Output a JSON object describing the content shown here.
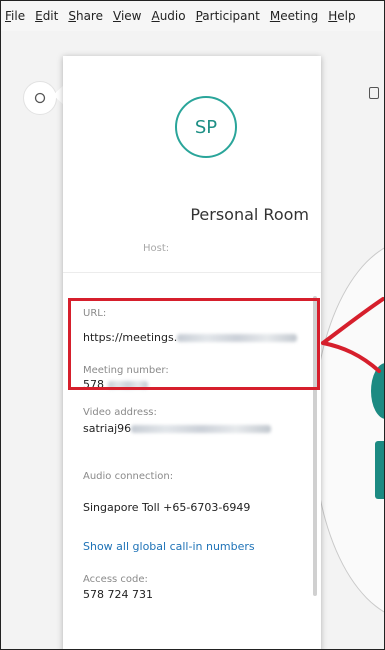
{
  "menubar": {
    "items": [
      {
        "key": "F",
        "rest": "ile"
      },
      {
        "key": "E",
        "rest": "dit"
      },
      {
        "key": "S",
        "rest": "hare"
      },
      {
        "key": "V",
        "rest": "iew"
      },
      {
        "key": "A",
        "rest": "udio"
      },
      {
        "key": "P",
        "rest": "articipant"
      },
      {
        "key": "M",
        "rest": "eeting"
      },
      {
        "key": "H",
        "rest": "elp"
      }
    ]
  },
  "panel": {
    "avatar_initials": "SP",
    "title": "Personal Room",
    "host_label": "Host:",
    "url_label": "URL:",
    "url_value": "https://meetings.",
    "meeting_number_label": "Meeting number:",
    "meeting_number_value": "578",
    "video_address_label": "Video address:",
    "video_address_value": "satriaj96",
    "audio_connection_label": "Audio connection:",
    "audio_connection_value": "Singapore Toll +65-6703-6949",
    "global_callin_link": "Show all global call-in numbers",
    "access_code_label": "Access code:",
    "access_code_value": "578 724 731"
  },
  "colors": {
    "accent": "#2aa59a",
    "highlight": "#d61f2c",
    "link": "#1f73b7"
  }
}
